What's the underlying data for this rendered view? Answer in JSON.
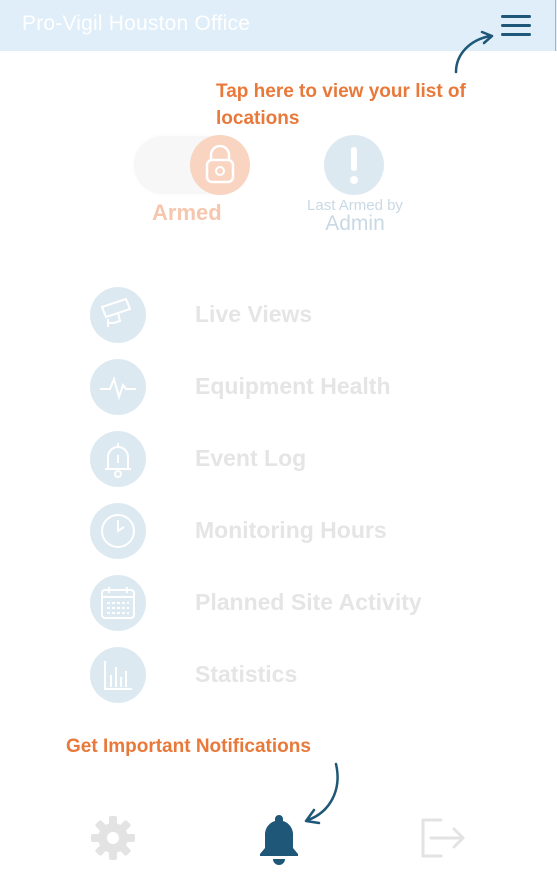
{
  "header": {
    "title": "Pro-Vigil Houston Office",
    "menu_icon": "hamburger-menu-icon"
  },
  "tips": {
    "locations": "Tap here to view your list of locations",
    "notifications": "Get Important Notifications"
  },
  "arm_status": {
    "label": "Armed",
    "last_armed_prefix": "Last Armed by",
    "last_armed_user": "Admin"
  },
  "menu": [
    {
      "label": "Live Views",
      "icon": "cctv-camera-icon"
    },
    {
      "label": "Equipment Health",
      "icon": "heartbeat-icon"
    },
    {
      "label": "Event Log",
      "icon": "bell-icon"
    },
    {
      "label": "Monitoring Hours",
      "icon": "clock-icon"
    },
    {
      "label": "Planned Site Activity",
      "icon": "calendar-icon"
    },
    {
      "label": "Statistics",
      "icon": "bar-chart-icon"
    }
  ],
  "bottom_nav": [
    {
      "icon": "gear-icon"
    },
    {
      "icon": "notification-bell-icon"
    },
    {
      "icon": "logout-icon"
    }
  ],
  "colors": {
    "header_bg": "#dfeef8",
    "accent_orange": "#e8793a",
    "navy": "#1e5777",
    "icon_circle": "#dde9f1"
  }
}
